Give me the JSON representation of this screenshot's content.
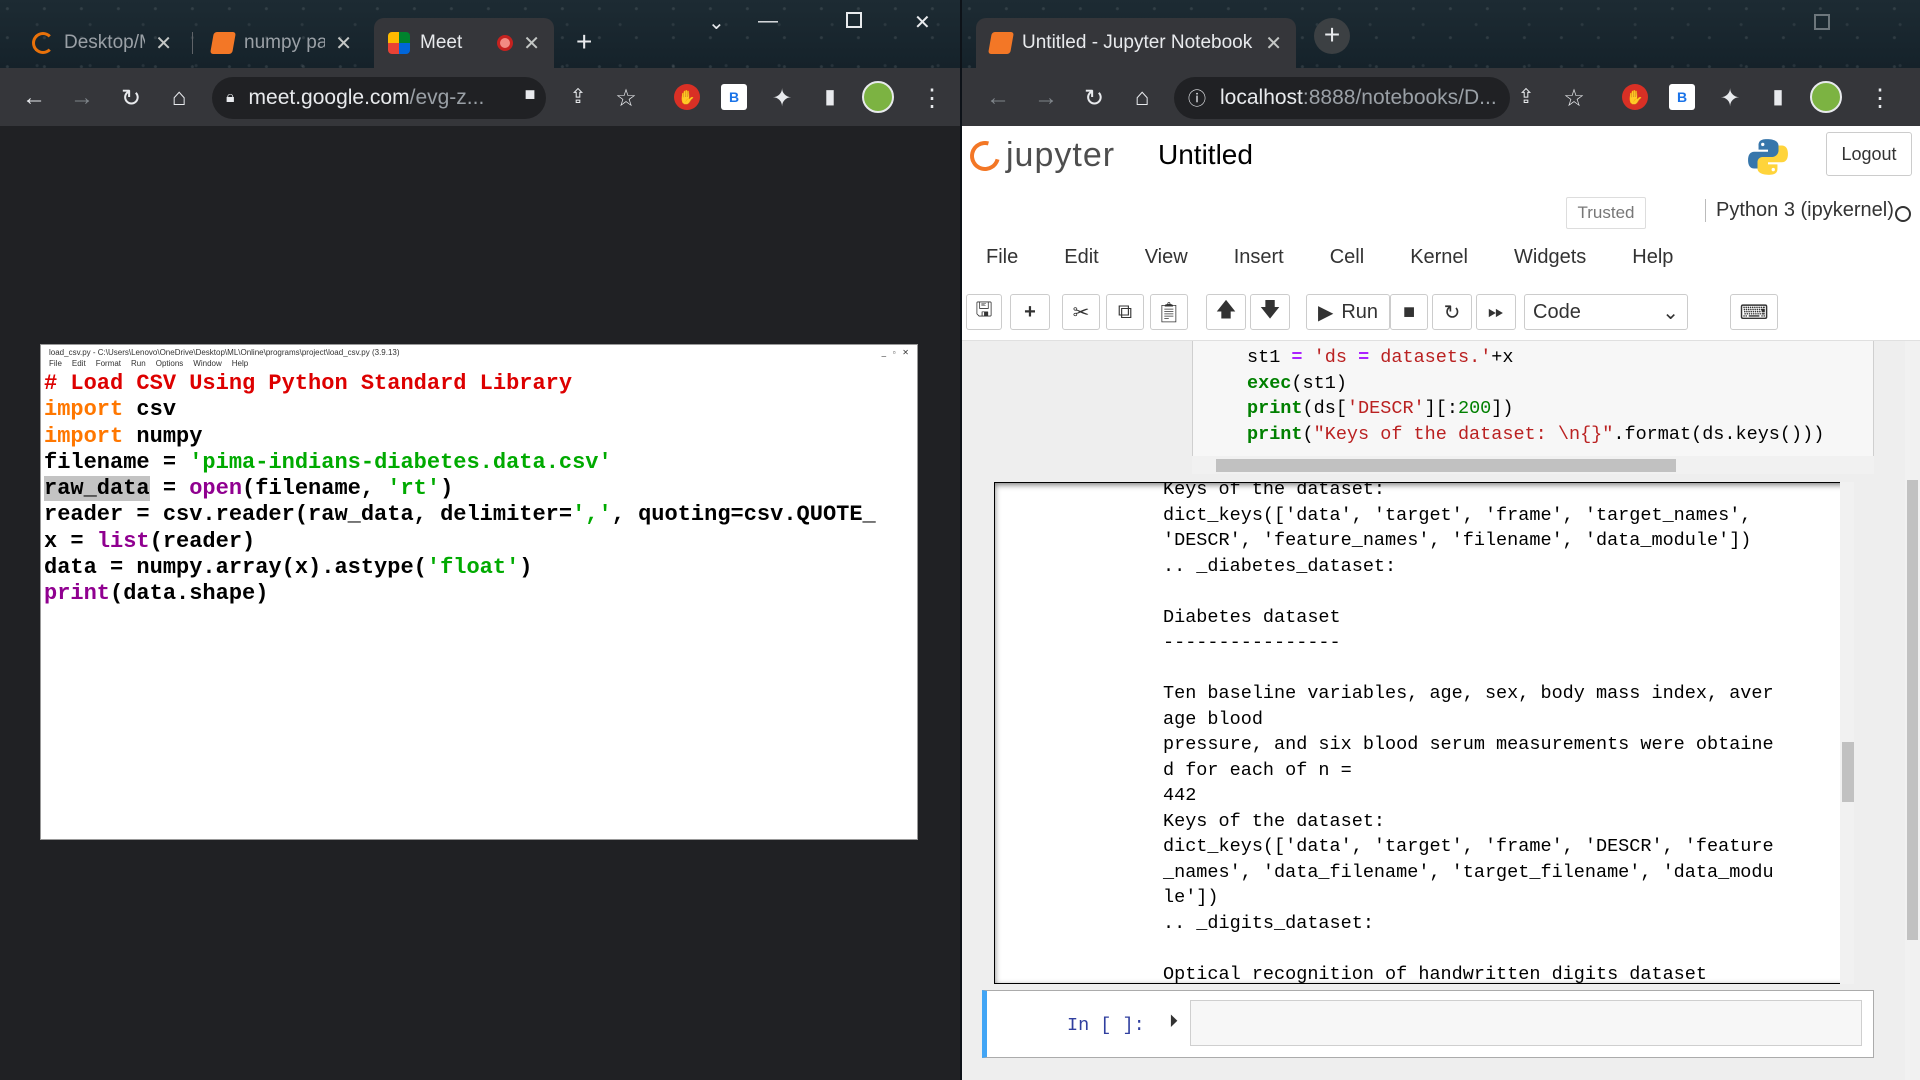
{
  "left_window": {
    "tabs": [
      {
        "title": "Desktop/M",
        "icon": "loading-spinner-icon"
      },
      {
        "title": "numpy pa",
        "icon": "notebook-icon"
      },
      {
        "title": "Meet",
        "icon": "google-meet-icon"
      }
    ],
    "url_host": "meet.google.com",
    "url_path": "/evg-z...",
    "extensions": [
      "B"
    ]
  },
  "shared_screen": {
    "title": "load_csv.py - C:\\Users\\Lenovo\\OneDrive\\Desktop\\ML\\Online\\programs\\project\\load_csv.py (3.9.13)",
    "menu": [
      "File",
      "Edit",
      "Format",
      "Run",
      "Options",
      "Window",
      "Help"
    ],
    "code_lines": [
      "# Load CSV Using Python Standard Library",
      "import csv",
      "import numpy",
      "filename = 'pima-indians-diabetes.data.csv'",
      "raw_data = open(filename, 'rt')",
      "reader = csv.reader(raw_data, delimiter=',', quoting=csv.QUOTE_",
      "x = list(reader)",
      "data = numpy.array(x).astype('float')",
      "print(data.shape)"
    ]
  },
  "right_window": {
    "tab_title": "Untitled - Jupyter Notebook",
    "url_host": "localhost",
    "url_path": ":8888/notebooks/D...",
    "extensions": [
      "B"
    ]
  },
  "jupyter": {
    "logo_text": "jupyter",
    "notebook_name": "Untitled",
    "logout_label": "Logout",
    "trusted_label": "Trusted",
    "kernel_name": "Python 3 (ipykernel)",
    "menu": [
      "File",
      "Edit",
      "View",
      "Insert",
      "Cell",
      "Kernel",
      "Widgets",
      "Help"
    ],
    "run_label": "Run",
    "cell_type": "Code",
    "input_lines": [
      "st1 = 'ds = datasets.'+x",
      "exec(st1)",
      "print(ds['DESCR'][:200])",
      "print(\"Keys of the dataset: \\n{}\".format(ds.keys()))"
    ],
    "output_text": "Keys of the dataset:\ndict_keys(['data', 'target', 'frame', 'target_names', 'DESCR', 'feature_names', 'filename', 'data_module'])\n.. _diabetes_dataset:\n\nDiabetes dataset\n----------------\n\nTen baseline variables, age, sex, body mass index, average blood\npressure, and six blood serum measurements were obtained for each of n =\n442\nKeys of the dataset:\ndict_keys(['data', 'target', 'frame', 'DESCR', 'feature_names', 'data_filename', 'target_filename', 'data_module'])\n.. _digits_dataset:\n\nOptical recognition of handwritten digits dataset",
    "empty_prompt": "In [ ]:"
  }
}
